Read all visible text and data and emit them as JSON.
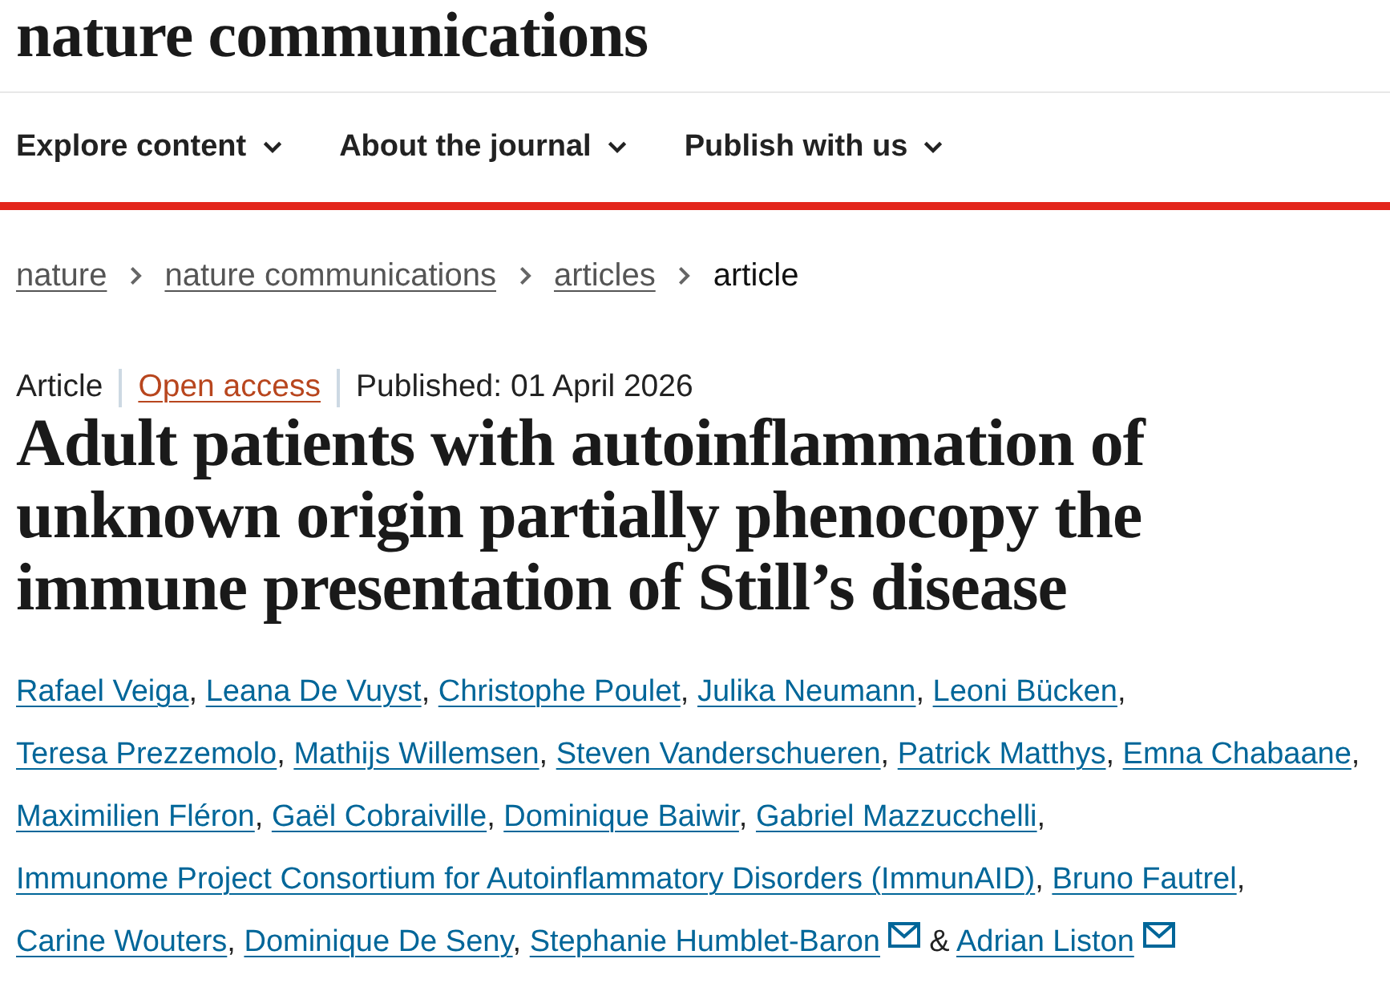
{
  "site": {
    "logo": "nature communications"
  },
  "nav": [
    {
      "label": "Explore content"
    },
    {
      "label": "About the journal"
    },
    {
      "label": "Publish with us"
    }
  ],
  "breadcrumb": [
    {
      "label": "nature",
      "kind": "link"
    },
    {
      "label": "nature communications",
      "kind": "link"
    },
    {
      "label": "articles",
      "kind": "link"
    },
    {
      "label": "article",
      "kind": "current"
    }
  ],
  "article": {
    "type": "Article",
    "access": "Open access",
    "published": "Published: 01 April 2026",
    "title": "Adult patients with autoinflammation of unknown origin partially phenocopy the immune presentation of Still’s disease",
    "authors": [
      {
        "name": "Rafael Veiga",
        "email": false,
        "after": ","
      },
      {
        "name": "Leana De Vuyst",
        "email": false,
        "after": ","
      },
      {
        "name": "Christophe Poulet",
        "email": false,
        "after": ","
      },
      {
        "name": "Julika Neumann",
        "email": false,
        "after": ","
      },
      {
        "name": "Leoni Bücken",
        "email": false,
        "after": ","
      },
      {
        "name": "Teresa Prezzemolo",
        "email": false,
        "after": ","
      },
      {
        "name": "Mathijs Willemsen",
        "email": false,
        "after": ","
      },
      {
        "name": "Steven Vanderschueren",
        "email": false,
        "after": ","
      },
      {
        "name": "Patrick Matthys",
        "email": false,
        "after": ","
      },
      {
        "name": "Emna Chabaane",
        "email": false,
        "after": ","
      },
      {
        "name": "Maximilien Fléron",
        "email": false,
        "after": ","
      },
      {
        "name": "Gaël Cobraiville",
        "email": false,
        "after": ","
      },
      {
        "name": "Dominique Baiwir",
        "email": false,
        "after": ","
      },
      {
        "name": "Gabriel Mazzucchelli",
        "email": false,
        "after": ","
      },
      {
        "name": "Immunome Project Consortium for Autoinflammatory Disorders (ImmunAID)",
        "email": false,
        "after": ","
      },
      {
        "name": "Bruno Fautrel",
        "email": false,
        "after": ","
      },
      {
        "name": "Carine Wouters",
        "email": false,
        "after": ","
      },
      {
        "name": "Dominique De Seny",
        "email": false,
        "after": ","
      },
      {
        "name": "Stephanie Humblet-Baron",
        "email": true,
        "after": "&"
      },
      {
        "name": "Adrian Liston",
        "email": true
      }
    ]
  }
}
